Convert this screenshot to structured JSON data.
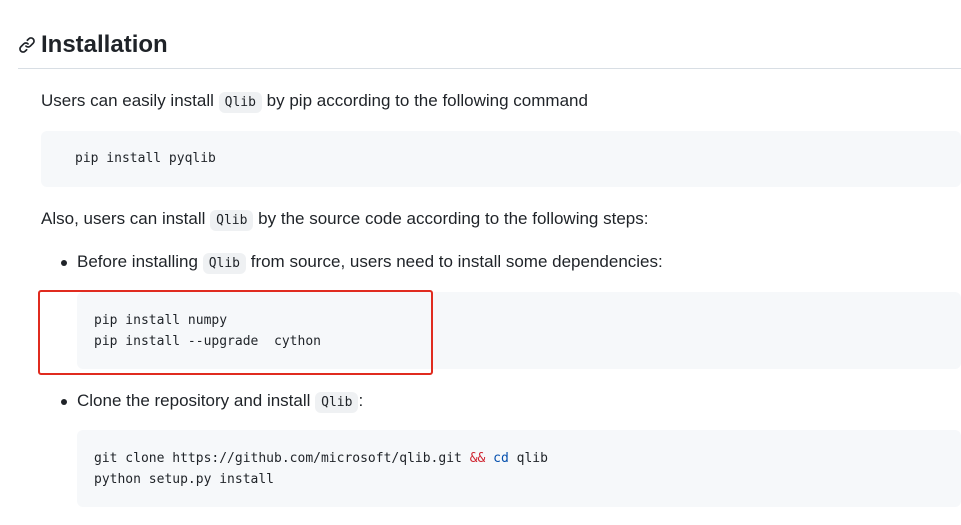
{
  "heading": {
    "icon": "link-icon",
    "title": "Installation"
  },
  "intro": {
    "before": "Users can easily install ",
    "code": "Qlib",
    "after": " by pip according to the following command"
  },
  "pip_block": {
    "line1": "pip install pyqlib"
  },
  "source_intro": {
    "before": "Also, users can install ",
    "code": "Qlib",
    "after": " by the source code according to the following steps:"
  },
  "steps": [
    {
      "before": "Before installing ",
      "code": "Qlib",
      "after": " from source, users need to install some dependencies:",
      "block_line1": "pip install numpy",
      "block_line2": "pip install --upgrade  cython"
    },
    {
      "before": "Clone the repository and install ",
      "code": "Qlib",
      "after": ":",
      "block_line1_a": "git clone https://github.com/microsoft/qlib.git ",
      "block_line1_op": "&&",
      "block_line1_cmd": "cd",
      "block_line1_arg": " qlib",
      "block_line2": "python setup.py install"
    }
  ],
  "colors": {
    "highlight": "#e02b1f",
    "code_bg": "#f6f8fa",
    "operator": "#cf222e",
    "builtin": "#0550ae"
  }
}
